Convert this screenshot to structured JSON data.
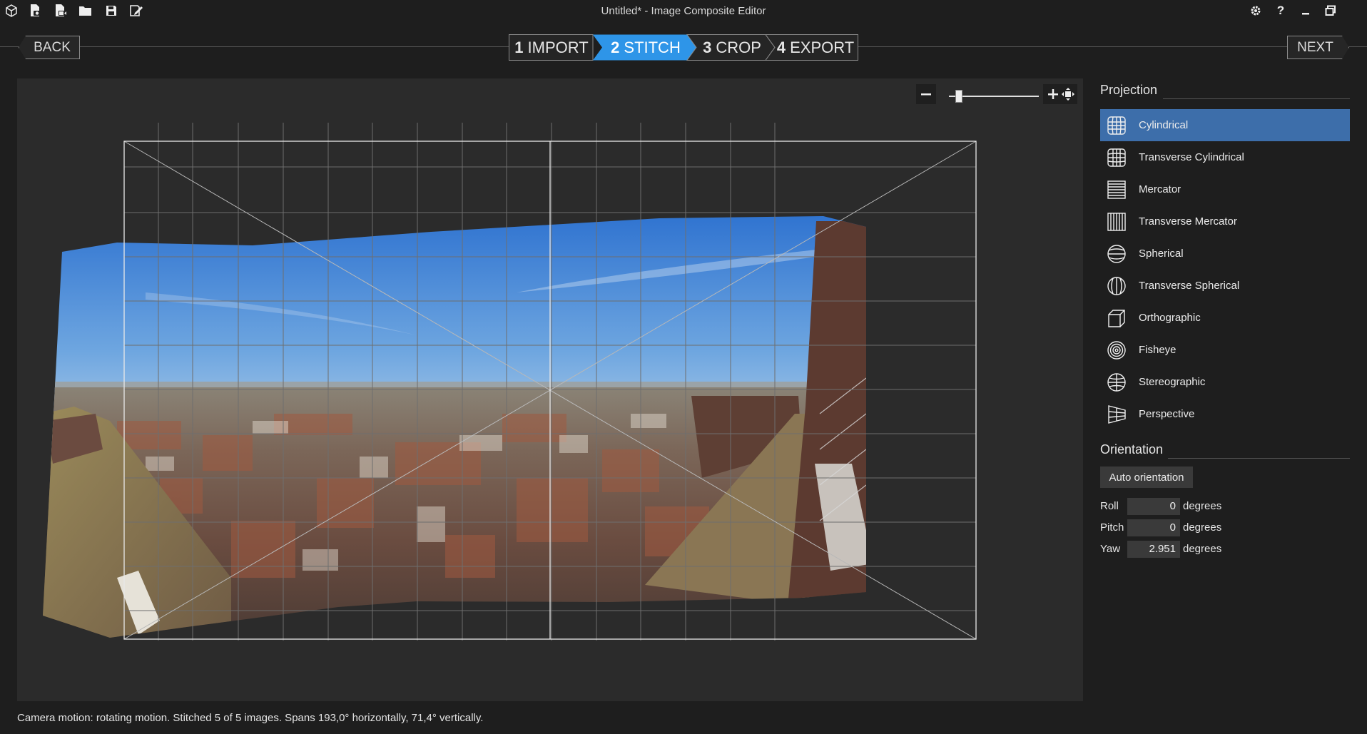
{
  "app": {
    "title": "Untitled* - Image Composite Editor"
  },
  "toolbar": {
    "icons": [
      "app-cube-icon",
      "new-panorama-icon",
      "new-panorama-from-video-icon",
      "open-folder-icon",
      "save-icon",
      "save-as-icon"
    ],
    "window_icons": [
      "settings-gear-icon",
      "help-icon",
      "minimize-icon",
      "restore-icon"
    ]
  },
  "nav": {
    "back_label": "BACK",
    "next_label": "NEXT",
    "steps": [
      {
        "num": "1",
        "label": "IMPORT",
        "active": false
      },
      {
        "num": "2",
        "label": "STITCH",
        "active": true
      },
      {
        "num": "3",
        "label": "CROP",
        "active": false
      },
      {
        "num": "4",
        "label": "EXPORT",
        "active": false
      }
    ],
    "accent_color": "#2e95e8"
  },
  "zoom": {
    "level_fraction": 0.08
  },
  "projection": {
    "heading": "Projection",
    "items": [
      {
        "label": "Cylindrical",
        "icon": "cylindrical-icon",
        "selected": true
      },
      {
        "label": "Transverse Cylindrical",
        "icon": "transverse-cylindrical-icon",
        "selected": false
      },
      {
        "label": "Mercator",
        "icon": "mercator-icon",
        "selected": false
      },
      {
        "label": "Transverse Mercator",
        "icon": "transverse-mercator-icon",
        "selected": false
      },
      {
        "label": "Spherical",
        "icon": "spherical-icon",
        "selected": false
      },
      {
        "label": "Transverse Spherical",
        "icon": "transverse-spherical-icon",
        "selected": false
      },
      {
        "label": "Orthographic",
        "icon": "orthographic-icon",
        "selected": false
      },
      {
        "label": "Fisheye",
        "icon": "fisheye-icon",
        "selected": false
      },
      {
        "label": "Stereographic",
        "icon": "stereographic-icon",
        "selected": false
      },
      {
        "label": "Perspective",
        "icon": "perspective-icon",
        "selected": false
      }
    ],
    "selected_color": "#3d6eaa"
  },
  "orientation": {
    "heading": "Orientation",
    "auto_label": "Auto orientation",
    "unit": "degrees",
    "roll": {
      "label": "Roll",
      "value": "0"
    },
    "pitch": {
      "label": "Pitch",
      "value": "0"
    },
    "yaw": {
      "label": "Yaw",
      "value": "2.951"
    }
  },
  "status": {
    "text": "Camera motion: rotating motion. Stitched 5 of 5 images. Spans 193,0° horizontally, 71,4° vertically."
  }
}
